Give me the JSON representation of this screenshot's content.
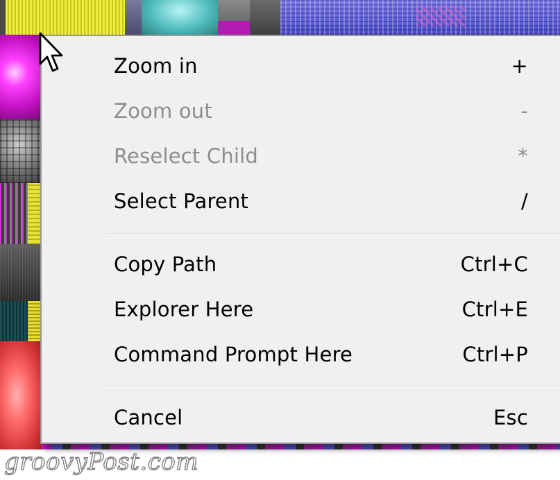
{
  "context_menu": {
    "items": [
      {
        "label": "Zoom in",
        "shortcut": "+",
        "enabled": true
      },
      {
        "label": "Zoom out",
        "shortcut": "-",
        "enabled": false
      },
      {
        "label": "Reselect Child",
        "shortcut": "*",
        "enabled": false
      },
      {
        "label": "Select Parent",
        "shortcut": "/",
        "enabled": true
      },
      {
        "label": "Copy Path",
        "shortcut": "Ctrl+C",
        "enabled": true
      },
      {
        "label": "Explorer Here",
        "shortcut": "Ctrl+E",
        "enabled": true
      },
      {
        "label": "Command Prompt Here",
        "shortcut": "Ctrl+P",
        "enabled": true
      },
      {
        "label": "Cancel",
        "shortcut": "Esc",
        "enabled": true
      }
    ]
  },
  "watermark": {
    "text": "groovyPost.com"
  },
  "colors": {
    "menu_background": "#f0f0f0",
    "menu_border": "#979797",
    "disabled_text": "#8d8d8d",
    "enabled_text": "#000000"
  },
  "icons": {
    "cursor": "arrow-cursor-icon"
  }
}
